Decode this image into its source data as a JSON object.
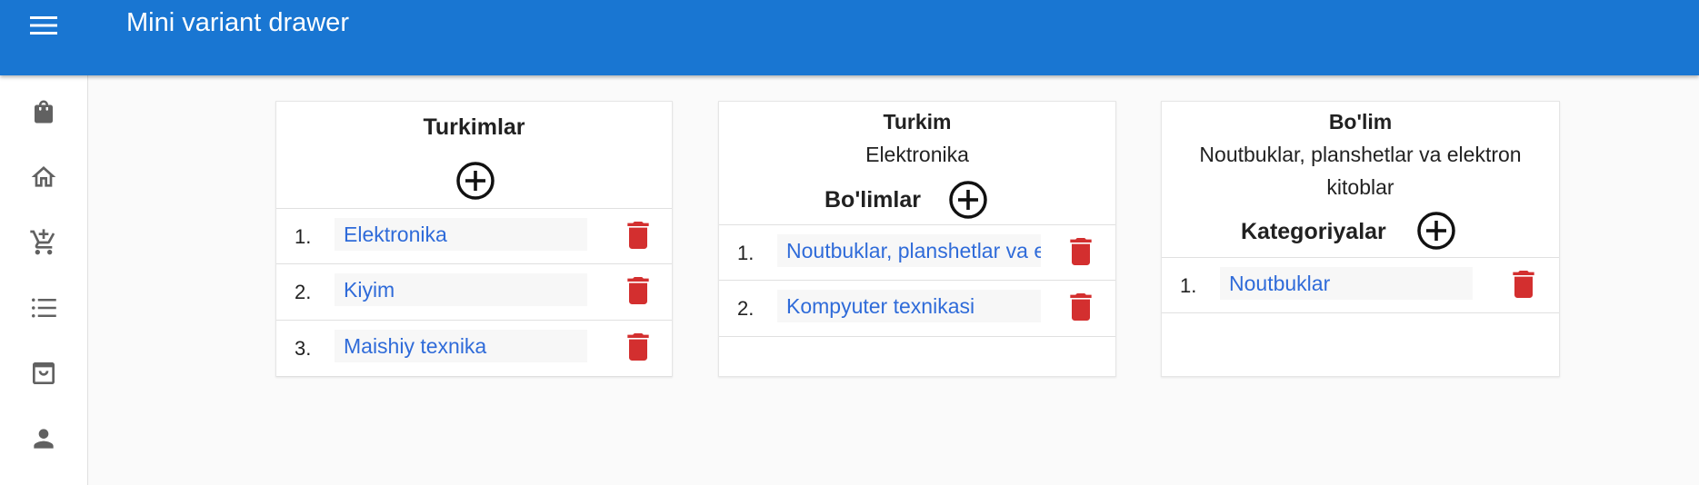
{
  "appbar": {
    "title": "Mini variant drawer",
    "menu_icon": "menu-icon",
    "color": "#1976d2"
  },
  "drawer": {
    "items": [
      {
        "icon": "shopping-bag-icon"
      },
      {
        "icon": "home-icon"
      },
      {
        "icon": "add-to-cart-icon"
      },
      {
        "icon": "list-icon"
      },
      {
        "icon": "store-icon"
      },
      {
        "icon": "person-icon"
      }
    ]
  },
  "card1": {
    "title": "Turkimlar",
    "items": [
      {
        "num": "1.",
        "label": "Elektronika"
      },
      {
        "num": "2.",
        "label": "Kiyim"
      },
      {
        "num": "3.",
        "label": "Maishiy texnika"
      }
    ]
  },
  "card2": {
    "title": "Turkim",
    "subtitle": "Elektronika",
    "section_label": "Bo'limlar",
    "items": [
      {
        "num": "1.",
        "label": "Noutbuklar, planshetlar va elektron kitoblar"
      },
      {
        "num": "2.",
        "label": "Kompyuter texnikasi"
      }
    ]
  },
  "card3": {
    "title": "Bo'lim",
    "subtitle_line1": "Noutbuklar, planshetlar va elektron",
    "subtitle_line2": "kitoblar",
    "section_label": "Kategoriyalar",
    "items": [
      {
        "num": "1.",
        "label": "Noutbuklar"
      }
    ]
  },
  "colors": {
    "link": "#2f6bd9",
    "delete": "#d32f2f",
    "drawer_icon": "#616161"
  }
}
